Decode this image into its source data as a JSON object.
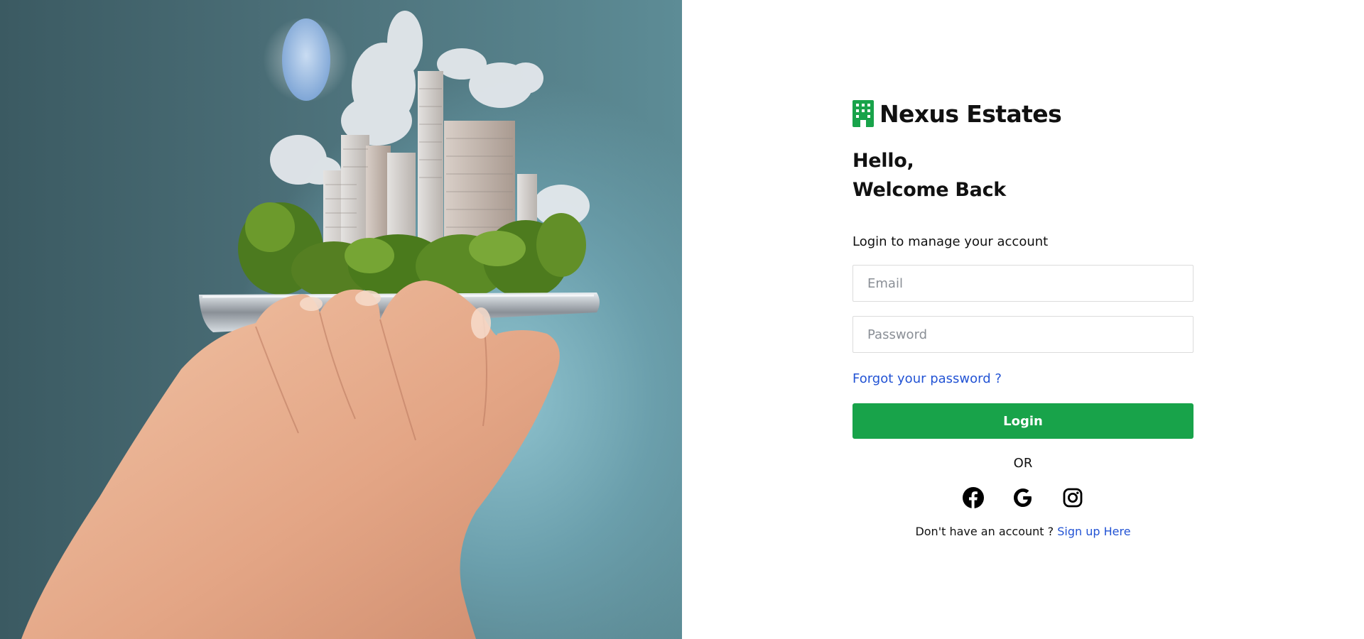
{
  "brand": {
    "name": "Nexus Estates",
    "icon": "building-icon",
    "accent_color": "#18a34a"
  },
  "greeting": {
    "line1": "Hello,",
    "line2": "Welcome Back"
  },
  "form": {
    "subtitle": "Login to manage your account",
    "email": {
      "placeholder": "Email",
      "value": ""
    },
    "password": {
      "placeholder": "Password",
      "value": ""
    },
    "forgot_link": "Forgot your password ?",
    "login_label": "Login",
    "separator": "OR"
  },
  "social": [
    {
      "name": "facebook-icon"
    },
    {
      "name": "google-icon"
    },
    {
      "name": "instagram-icon"
    }
  ],
  "signup": {
    "prompt": "Don't have an account ?",
    "link": "Sign up Here"
  },
  "colors": {
    "link": "#2253d4",
    "button": "#18a34a",
    "background": "#ffffff"
  }
}
